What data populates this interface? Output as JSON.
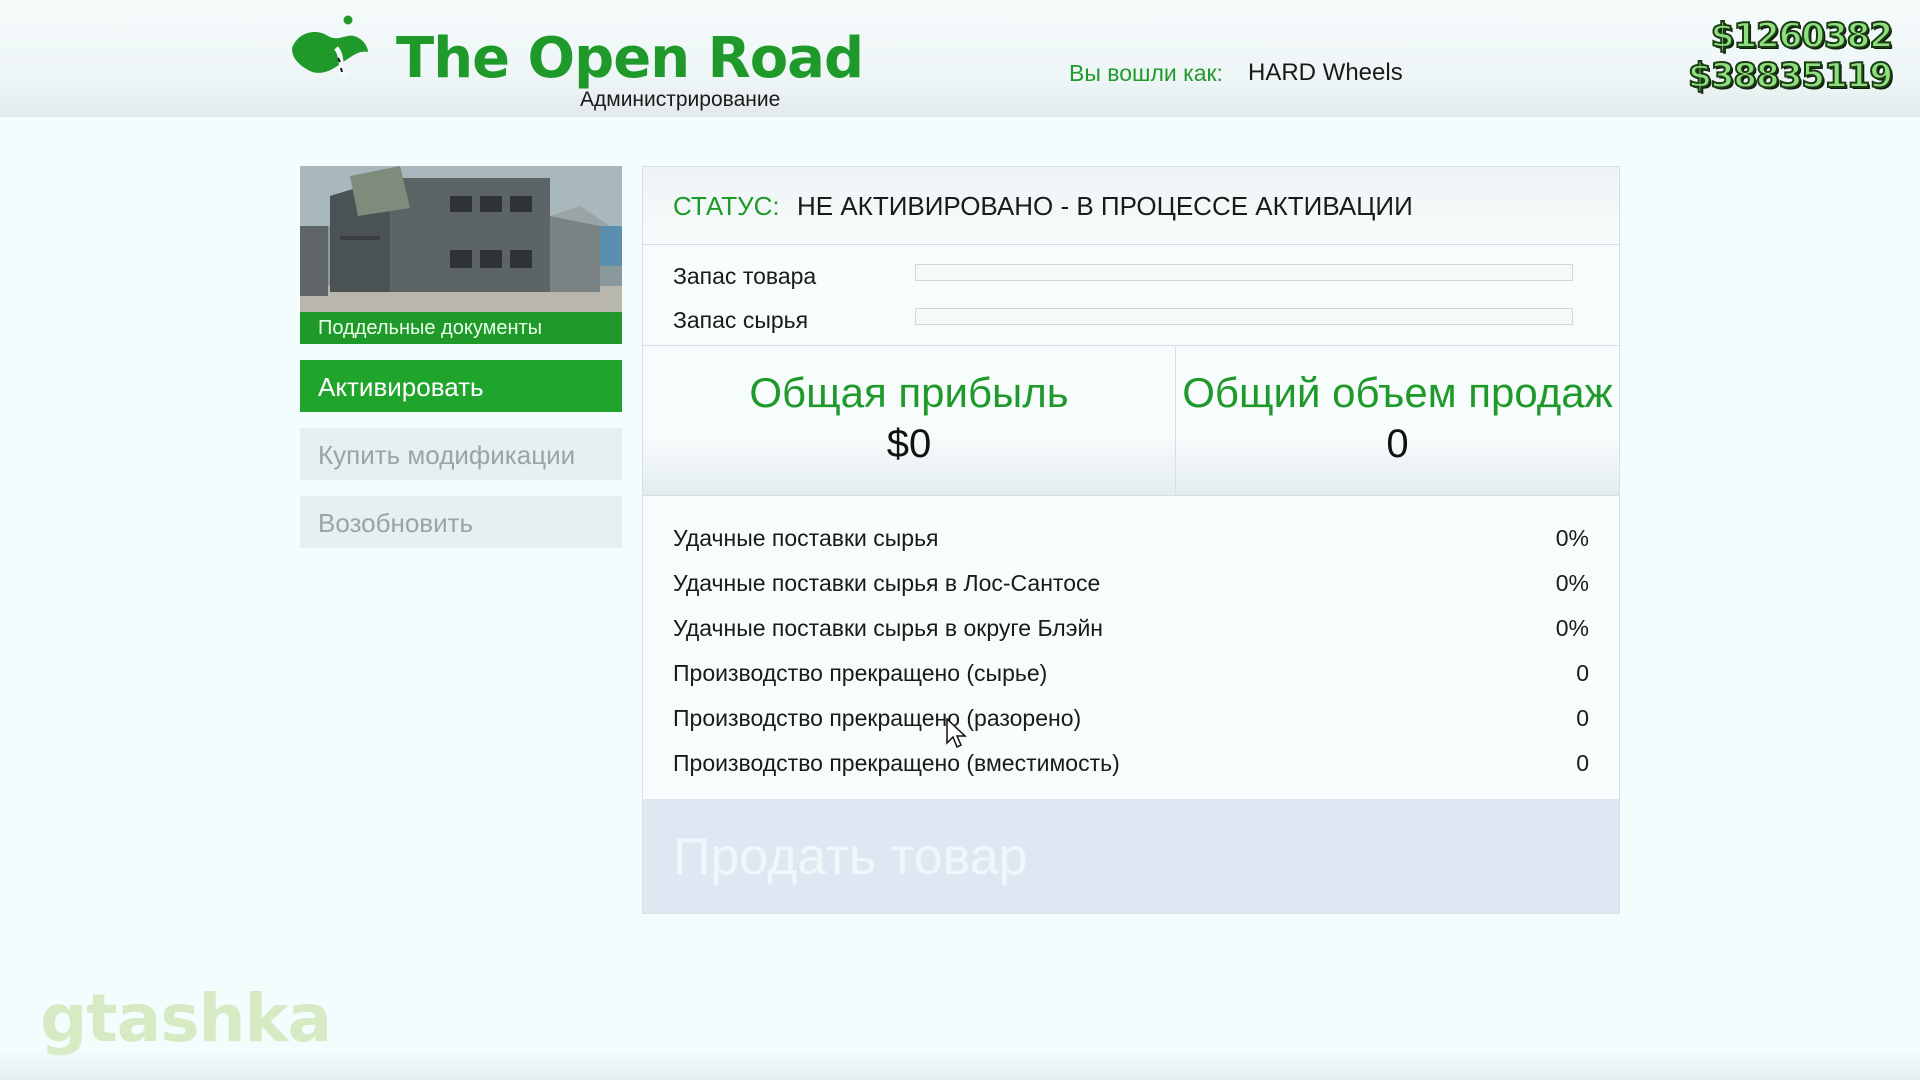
{
  "header": {
    "logo_icon": "open-road-logo-icon",
    "title": "The Open Road",
    "subtitle": "Администрирование",
    "login_label": "Вы вошли как:",
    "login_user": "HARD Wheels",
    "cash": "$1260382",
    "bank": "$38835119"
  },
  "sidebar": {
    "property_caption": "Поддельные документы",
    "buttons": [
      {
        "label": "Активировать",
        "state": "active"
      },
      {
        "label": "Купить модификации",
        "state": "disabled"
      },
      {
        "label": "Возобновить",
        "state": "disabled"
      }
    ]
  },
  "panel": {
    "status_label": "СТАТУС:",
    "status_value": "НЕ АКТИВИРОВАНО - В ПРОЦЕССЕ АКТИВАЦИИ",
    "stock": [
      {
        "label": "Запас товара",
        "level": 0
      },
      {
        "label": "Запас сырья",
        "level": 0
      }
    ],
    "totals": [
      {
        "title": "Общая прибыль",
        "value": "$0"
      },
      {
        "title": "Общий объем продаж",
        "value": "0"
      }
    ],
    "stats": [
      {
        "label": "Удачные поставки сырья",
        "value": "0%"
      },
      {
        "label": "Удачные поставки сырья в Лос-Сантосе",
        "value": "0%"
      },
      {
        "label": "Удачные поставки сырья в округе Блэйн",
        "value": "0%"
      },
      {
        "label": "Производство прекращено (сырье)",
        "value": "0"
      },
      {
        "label": "Производство прекращено (разорено)",
        "value": "0"
      },
      {
        "label": "Производство прекращено (вместимость)",
        "value": "0"
      }
    ],
    "sell_label": "Продать товар"
  },
  "watermark": "gtashka",
  "colors": {
    "accent": "#1f9a2a",
    "background": "#f4fdfd",
    "disabled_button": "#e6eff2",
    "sell_area": "#dde8f2"
  }
}
